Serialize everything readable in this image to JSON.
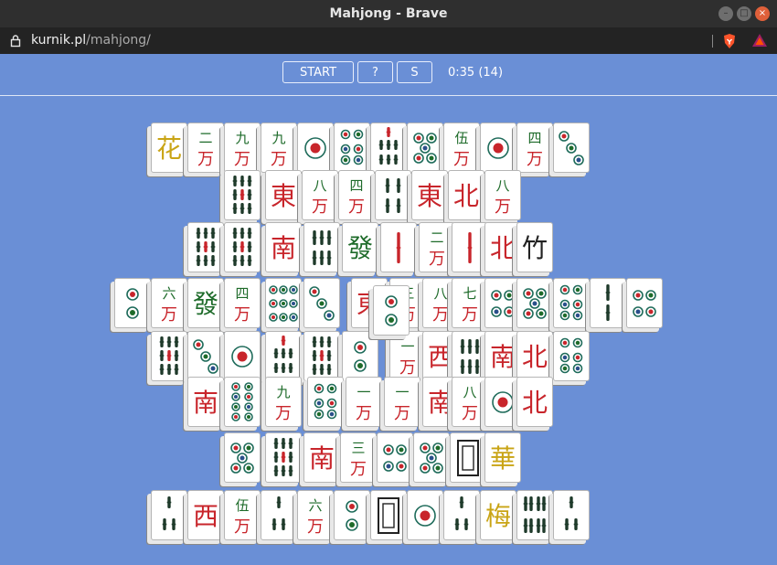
{
  "window": {
    "title": "Mahjong - Brave"
  },
  "address": {
    "host": "kurnik.pl",
    "path": "/mahjong/"
  },
  "toolbar": {
    "start_label": "START",
    "help_label": "?",
    "s_label": "S",
    "timer": "0:35 (14)"
  },
  "colors": {
    "background": "#6a8fd6",
    "red": "#c8252b",
    "green": "#1e6b2a",
    "gold": "#c9a415",
    "blue": "#2a4f8a"
  },
  "tiles": [
    {
      "c": "flower",
      "t": "花",
      "col": "gold"
    },
    {
      "c": "char",
      "n": "二",
      "t": "万"
    },
    {
      "c": "char",
      "n": "九",
      "t": "万"
    },
    {
      "c": "char",
      "n": "九",
      "t": "万"
    },
    {
      "c": "dot",
      "k": 1
    },
    {
      "c": "dot",
      "k": 6
    },
    {
      "c": "bam",
      "k": 7
    },
    {
      "c": "dot",
      "k": 5
    },
    {
      "c": "char",
      "n": "伍",
      "t": "万"
    },
    {
      "c": "dot",
      "k": 1
    },
    {
      "c": "char",
      "n": "四",
      "t": "万"
    },
    {
      "c": "dot",
      "k": 3
    },
    {
      "c": "bam",
      "k": 9
    },
    {
      "c": "wind",
      "t": "東"
    },
    {
      "c": "char",
      "n": "八",
      "t": "万"
    },
    {
      "c": "char",
      "n": "四",
      "t": "万"
    },
    {
      "c": "bam",
      "k": 4
    },
    {
      "c": "wind",
      "t": "東"
    },
    {
      "c": "wind",
      "t": "北"
    },
    {
      "c": "char",
      "n": "八",
      "t": "万"
    },
    {
      "c": "bam",
      "k": 9
    },
    {
      "c": "bam",
      "k": 9
    },
    {
      "c": "wind",
      "t": "南"
    },
    {
      "c": "bam",
      "k": 6
    },
    {
      "c": "dragon",
      "t": "發",
      "col": "green"
    },
    {
      "c": "bam",
      "k": 1
    },
    {
      "c": "char",
      "n": "二",
      "t": "万"
    },
    {
      "c": "bam",
      "k": 1
    },
    {
      "c": "wind",
      "t": "北"
    },
    {
      "c": "season",
      "t": "竹"
    },
    {
      "c": "dot",
      "k": 2
    },
    {
      "c": "char",
      "n": "六",
      "t": "万"
    },
    {
      "c": "dragon",
      "t": "發",
      "col": "green"
    },
    {
      "c": "char",
      "n": "四",
      "t": "万"
    },
    {
      "c": "dot",
      "k": 9
    },
    {
      "c": "dot",
      "k": 3
    },
    {
      "c": "wind",
      "t": "東"
    },
    {
      "c": "char",
      "n": "三",
      "t": "万"
    },
    {
      "c": "char",
      "n": "八",
      "t": "万"
    },
    {
      "c": "char",
      "n": "七",
      "t": "万"
    },
    {
      "c": "dot",
      "k": 4
    },
    {
      "c": "dot",
      "k": 5
    },
    {
      "c": "dot",
      "k": 6
    },
    {
      "c": "bam",
      "k": 2
    },
    {
      "c": "dot",
      "k": 4
    },
    {
      "c": "bam",
      "k": 9
    },
    {
      "c": "dot",
      "k": 3
    },
    {
      "c": "dot",
      "k": 1
    },
    {
      "c": "bam",
      "k": 7
    },
    {
      "c": "bam",
      "k": 9
    },
    {
      "c": "dot",
      "k": 2
    },
    {
      "c": "char",
      "n": "一",
      "t": "万"
    },
    {
      "c": "wind",
      "t": "西"
    },
    {
      "c": "bam",
      "k": 6
    },
    {
      "c": "wind",
      "t": "南"
    },
    {
      "c": "wind",
      "t": "北"
    },
    {
      "c": "dot",
      "k": 6
    },
    {
      "c": "wind",
      "t": "南"
    },
    {
      "c": "dot",
      "k": 8
    },
    {
      "c": "char",
      "n": "九",
      "t": "万"
    },
    {
      "c": "dot",
      "k": 6
    },
    {
      "c": "char",
      "n": "一",
      "t": "万"
    },
    {
      "c": "char",
      "n": "一",
      "t": "万"
    },
    {
      "c": "wind",
      "t": "南"
    },
    {
      "c": "char",
      "n": "八",
      "t": "万"
    },
    {
      "c": "dot",
      "k": 1
    },
    {
      "c": "wind",
      "t": "北"
    },
    {
      "c": "dot",
      "k": 5
    },
    {
      "c": "bam",
      "k": 9
    },
    {
      "c": "wind",
      "t": "南"
    },
    {
      "c": "char",
      "n": "三",
      "t": "万"
    },
    {
      "c": "dot",
      "k": 4
    },
    {
      "c": "dot",
      "k": 5
    },
    {
      "c": "whitedragon"
    },
    {
      "c": "flower",
      "t": "華",
      "col": "gold"
    },
    {
      "c": "bam",
      "k": 3
    },
    {
      "c": "wind",
      "t": "西"
    },
    {
      "c": "char",
      "n": "伍",
      "t": "万"
    },
    {
      "c": "bam",
      "k": 3
    },
    {
      "c": "char",
      "n": "六",
      "t": "万"
    },
    {
      "c": "dot",
      "k": 2
    },
    {
      "c": "whitedragon"
    },
    {
      "c": "dot",
      "k": 1
    },
    {
      "c": "bam",
      "k": 3
    },
    {
      "c": "flower",
      "t": "梅",
      "col": "gold"
    },
    {
      "c": "bam",
      "k": 8
    },
    {
      "c": "bam",
      "k": 3
    },
    {
      "c": "wind",
      "t": "東"
    }
  ]
}
